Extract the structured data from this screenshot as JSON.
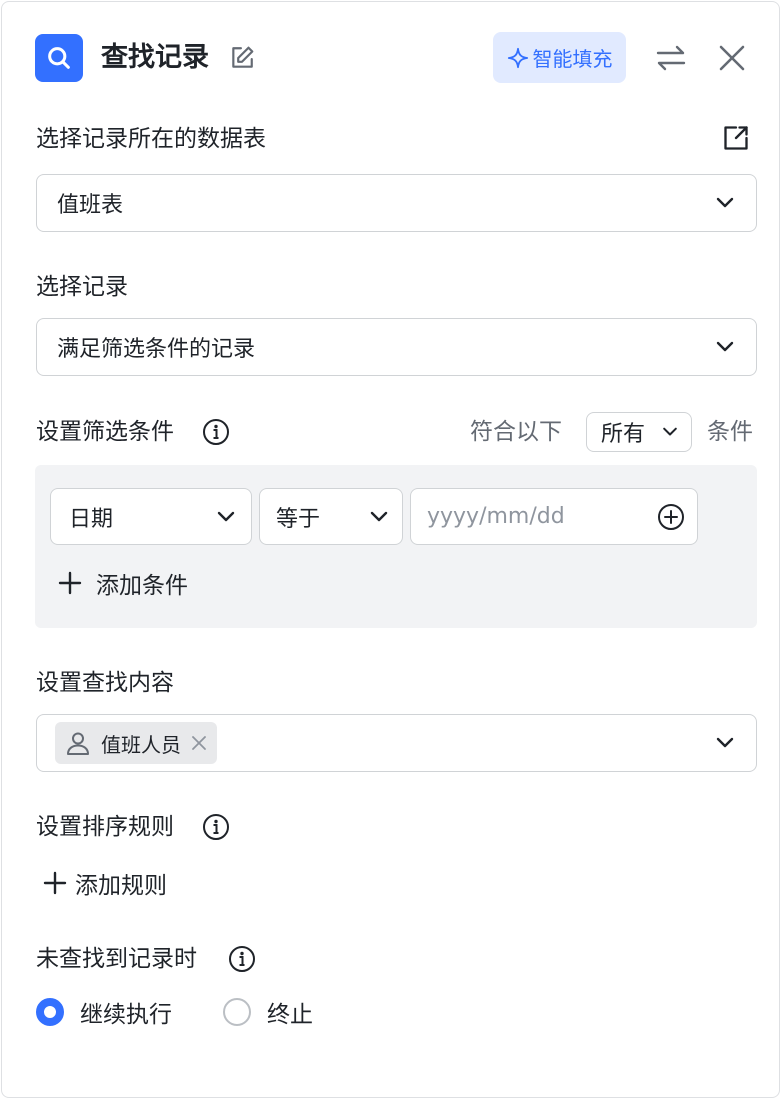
{
  "header": {
    "title": "查找记录",
    "smart_fill_label": "智能填充"
  },
  "table_section": {
    "label": "选择记录所在的数据表",
    "selected": "值班表"
  },
  "record_section": {
    "label": "选择记录",
    "selected": "满足筛选条件的记录"
  },
  "filter_section": {
    "label": "设置筛选条件",
    "match_prefix": "符合以下",
    "match_value": "所有",
    "match_suffix": "条件",
    "condition": {
      "field": "日期",
      "operator": "等于",
      "value_placeholder": "yyyy/mm/dd"
    },
    "add_condition_label": "添加条件"
  },
  "find_section": {
    "label": "设置查找内容",
    "tag_label": "值班人员"
  },
  "sort_section": {
    "label": "设置排序规则",
    "add_rule_label": "添加规则"
  },
  "not_found_section": {
    "label": "未查找到记录时",
    "options": [
      {
        "label": "继续执行",
        "selected": true
      },
      {
        "label": "终止",
        "selected": false
      }
    ]
  },
  "colors": {
    "accent": "#3370ff",
    "accent_light": "#e1eaff",
    "filter_bg": "#f2f3f5"
  }
}
